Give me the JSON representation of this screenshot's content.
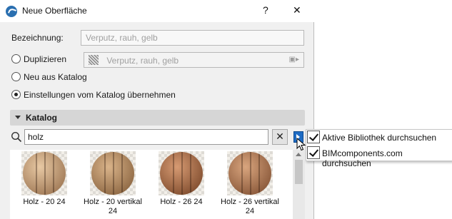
{
  "window": {
    "title": "Neue Oberfläche",
    "help_label": "?",
    "close_label": "✕"
  },
  "name_field": {
    "label": "Bezeichnung:",
    "placeholder": "Verputz, rauh, gelb"
  },
  "options": [
    {
      "label": "Duplizieren",
      "selected": false,
      "source_placeholder": "Verputz, rauh, gelb"
    },
    {
      "label": "Neu aus Katalog",
      "selected": false
    },
    {
      "label": "Einstellungen vom Katalog übernehmen",
      "selected": true
    }
  ],
  "catalog": {
    "header": "Katalog",
    "search_value": "holz",
    "clear_label": "✕",
    "items": [
      {
        "label": "Holz - 20 24",
        "color_light": "#e8c9a4",
        "color_dark": "#9c7552"
      },
      {
        "label": "Holz - 20 vertikal 24",
        "color_light": "#dab48a",
        "color_dark": "#8a6440"
      },
      {
        "label": "Holz - 26 24",
        "color_light": "#d69a72",
        "color_dark": "#7d4a2c"
      },
      {
        "label": "Holz - 26 vertikal 24",
        "color_light": "#d9a57e",
        "color_dark": "#855436"
      }
    ]
  },
  "search_options_menu": [
    {
      "label": "Aktive Bibliothek durchsuchen",
      "checked": true
    },
    {
      "label": "BIMcomponents.com durchsuchen",
      "checked": true
    }
  ],
  "colors": {
    "accent": "#1f6cc4"
  }
}
